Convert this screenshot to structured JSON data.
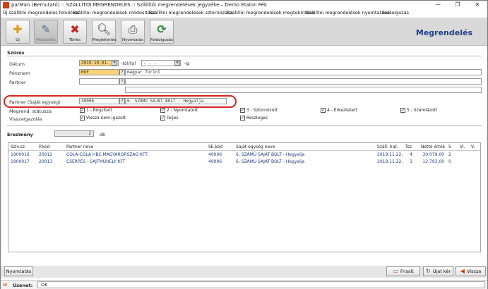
{
  "window": {
    "title": "parMan (Bemutató) :: SZÁLLÍTÓI MEGRENDELÉS :: Szállítói megrendelések jegyzéke  –  Demo Etalon Pék",
    "minimize": "—",
    "maximize": "❐",
    "close": "✕"
  },
  "menu": [
    "Új szállítói megrendelés felvétele",
    "Szállítói megrendelések módosítása",
    "Szállítói megrendelések sztornózása",
    "Szállítói megrendelések megtekintése",
    "Szállítói megrendelések nyomtatása",
    "Feldolgozás"
  ],
  "toolbar": {
    "buttons": [
      {
        "label": "Új",
        "icon": "plus-icon"
      },
      {
        "label": "Módosítás",
        "icon": "pencil-icon"
      },
      {
        "label": "Törlés",
        "icon": "delete-x-icon"
      },
      {
        "label": "Megtekintés",
        "icon": "magnifier-icon"
      },
      {
        "label": "Nyomtatás",
        "icon": "printer-icon"
      },
      {
        "label": "Feldolgozás",
        "icon": "process-icon"
      }
    ],
    "brand": "Megrendelés"
  },
  "filter": {
    "section_title": "Szűrés",
    "datum_label": "Dátum",
    "datum_from": "2019.10.01.",
    "datum_from_suffix": "-tól/tól",
    "datum_to": "  .  .  .",
    "datum_to_suffix": "-ig",
    "penznem_label": "Pénznem",
    "penznem_code": "HUF",
    "penznem_name": "magyar forint",
    "partner_label": "Partner",
    "partner_code": "",
    "partner_name": "",
    "sajat_label": "Partner (Saját egység)",
    "sajat_code": "40006",
    "sajat_name": "6. SZÁMÚ SAJÁT BOLT - Hegyalja",
    "q": "?",
    "status_label": "Megrend. státusza",
    "statuses": [
      "1 - Rögzített",
      "2 - Nyomtatott",
      "3 - Sztornózott",
      "4 - Érkeztetett",
      "5 - Számlázott"
    ],
    "return_label": "Visszaigazolás",
    "returns": [
      "Vissza nem igazolt",
      "Teljes",
      "Részleges"
    ],
    "check": "✓"
  },
  "result": {
    "section_title": "Eredmény",
    "count": "2",
    "unit": "db"
  },
  "table": {
    "headers": [
      "Szlv.sz.",
      "P.kód",
      "Partner neve",
      "SE.kód",
      "Saját egység neve",
      "Száll. hat.",
      "Tsz",
      "Nettó érték",
      "S",
      "Vi.",
      "V."
    ],
    "rows": [
      [
        "1900016",
        "20012",
        "COLA-COLA HBC MAGYARORSZÁG KFT.",
        "40006",
        "6. SZÁMÚ SAJÁT BOLT - Hegyalja",
        "2019.11.22.",
        "4",
        "30 079,00",
        "2",
        "",
        ""
      ],
      [
        "1900017",
        "20013",
        "CSERPES - SAJTMŰHELY KFT",
        "40006",
        "6. SZÁMÚ SAJÁT BOLT - Hegyalja",
        "2019.11.22.",
        "3",
        "12 793,00",
        "0",
        "",
        ""
      ]
    ]
  },
  "bottom": {
    "print_label": "Nyomtatás",
    "refresh_label": "Frissít",
    "newsearch_label": "Újat kér",
    "back_label": "Vissza"
  },
  "status": {
    "label": "Üzenet:",
    "message": "OK"
  }
}
